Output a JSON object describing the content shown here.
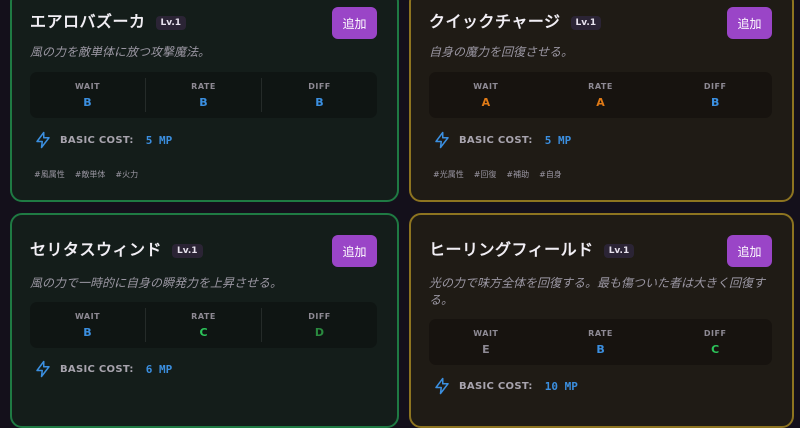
{
  "cards": [
    {
      "title": "エアロバズーカ",
      "level": "Lv.1",
      "add_label": "追加",
      "description": "風の力を敵単体に放つ攻撃魔法。",
      "stats": [
        {
          "label": "WAIT",
          "value": "B",
          "color": "#3b8fe0"
        },
        {
          "label": "RATE",
          "value": "B",
          "color": "#3b8fe0"
        },
        {
          "label": "DIFF",
          "value": "B",
          "color": "#3b8fe0"
        }
      ],
      "cost_label": "BASIC COST:",
      "cost_value": "5 MP",
      "cost_icon": "lightning-icon",
      "tags": [
        "#風属性",
        "#敵単体",
        "#火力"
      ]
    },
    {
      "title": "クイックチャージ",
      "level": "Lv.1",
      "add_label": "追加",
      "description": "自身の魔力を回復させる。",
      "stats": [
        {
          "label": "WAIT",
          "value": "A",
          "color": "#e07a16"
        },
        {
          "label": "RATE",
          "value": "A",
          "color": "#e07a16"
        },
        {
          "label": "DIFF",
          "value": "B",
          "color": "#3b8fe0"
        }
      ],
      "cost_label": "BASIC COST:",
      "cost_value": "5 MP",
      "cost_icon": "lightning-icon",
      "tags": [
        "#光属性",
        "#回復",
        "#補助",
        "#自身"
      ]
    },
    {
      "title": "セリタスウィンド",
      "level": "Lv.1",
      "add_label": "追加",
      "description": "風の力で一時的に自身の瞬発力を上昇させる。",
      "stats": [
        {
          "label": "WAIT",
          "value": "B",
          "color": "#3b8fe0"
        },
        {
          "label": "RATE",
          "value": "C",
          "color": "#2cc45a"
        },
        {
          "label": "DIFF",
          "value": "D",
          "color": "#2a8a3f"
        }
      ],
      "cost_label": "BASIC COST:",
      "cost_value": "6 MP",
      "cost_icon": "lightning-icon",
      "tags": []
    },
    {
      "title": "ヒーリングフィールド",
      "level": "Lv.1",
      "add_label": "追加",
      "description": "光の力で味方全体を回復する。最も傷ついた者は大きく回復する。",
      "stats": [
        {
          "label": "WAIT",
          "value": "E",
          "color": "#8e8a94"
        },
        {
          "label": "RATE",
          "value": "B",
          "color": "#3b8fe0"
        },
        {
          "label": "DIFF",
          "value": "C",
          "color": "#2cc45a"
        }
      ],
      "cost_label": "BASIC COST:",
      "cost_value": "10 MP",
      "cost_icon": "lightning-icon",
      "tags": []
    }
  ]
}
